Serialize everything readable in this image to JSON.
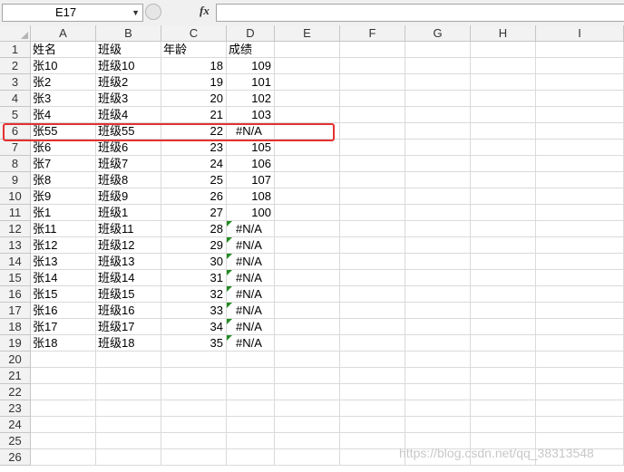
{
  "formula_bar": {
    "name_box": "E17",
    "fx_label": "fx",
    "formula": ""
  },
  "columns": [
    "A",
    "B",
    "C",
    "D",
    "E",
    "F",
    "G",
    "H",
    "I"
  ],
  "rows": [
    "1",
    "2",
    "3",
    "4",
    "5",
    "6",
    "7",
    "8",
    "9",
    "10",
    "11",
    "12",
    "13",
    "14",
    "15",
    "16",
    "17",
    "18",
    "19",
    "20",
    "21",
    "22",
    "23",
    "24",
    "25",
    "26"
  ],
  "table": [
    {
      "a": "姓名",
      "b": "班级",
      "c": "年龄",
      "d": "成绩",
      "c_type": "txt",
      "d_type": "txt",
      "flag": false
    },
    {
      "a": "张10",
      "b": "班级10",
      "c": "18",
      "d": "109",
      "c_type": "num",
      "d_type": "num",
      "flag": false
    },
    {
      "a": "张2",
      "b": "班级2",
      "c": "19",
      "d": "101",
      "c_type": "num",
      "d_type": "num",
      "flag": false
    },
    {
      "a": "张3",
      "b": "班级3",
      "c": "20",
      "d": "102",
      "c_type": "num",
      "d_type": "num",
      "flag": false
    },
    {
      "a": "张4",
      "b": "班级4",
      "c": "21",
      "d": "103",
      "c_type": "num",
      "d_type": "num",
      "flag": false
    },
    {
      "a": "张55",
      "b": "班级55",
      "c": "22",
      "d": "#N/A",
      "c_type": "num",
      "d_type": "err",
      "flag": false
    },
    {
      "a": "张6",
      "b": "班级6",
      "c": "23",
      "d": "105",
      "c_type": "num",
      "d_type": "num",
      "flag": false
    },
    {
      "a": "张7",
      "b": "班级7",
      "c": "24",
      "d": "106",
      "c_type": "num",
      "d_type": "num",
      "flag": false
    },
    {
      "a": "张8",
      "b": "班级8",
      "c": "25",
      "d": "107",
      "c_type": "num",
      "d_type": "num",
      "flag": false
    },
    {
      "a": "张9",
      "b": "班级9",
      "c": "26",
      "d": "108",
      "c_type": "num",
      "d_type": "num",
      "flag": false
    },
    {
      "a": "张1",
      "b": "班级1",
      "c": "27",
      "d": "100",
      "c_type": "num",
      "d_type": "num",
      "flag": false
    },
    {
      "a": "张11",
      "b": "班级11",
      "c": "28",
      "d": "#N/A",
      "c_type": "num",
      "d_type": "err",
      "flag": true
    },
    {
      "a": "张12",
      "b": "班级12",
      "c": "29",
      "d": "#N/A",
      "c_type": "num",
      "d_type": "err",
      "flag": true
    },
    {
      "a": "张13",
      "b": "班级13",
      "c": "30",
      "d": "#N/A",
      "c_type": "num",
      "d_type": "err",
      "flag": true
    },
    {
      "a": "张14",
      "b": "班级14",
      "c": "31",
      "d": "#N/A",
      "c_type": "num",
      "d_type": "err",
      "flag": true
    },
    {
      "a": "张15",
      "b": "班级15",
      "c": "32",
      "d": "#N/A",
      "c_type": "num",
      "d_type": "err",
      "flag": true
    },
    {
      "a": "张16",
      "b": "班级16",
      "c": "33",
      "d": "#N/A",
      "c_type": "num",
      "d_type": "err",
      "flag": true
    },
    {
      "a": "张17",
      "b": "班级17",
      "c": "34",
      "d": "#N/A",
      "c_type": "num",
      "d_type": "err",
      "flag": true
    },
    {
      "a": "张18",
      "b": "班级18",
      "c": "35",
      "d": "#N/A",
      "c_type": "num",
      "d_type": "err",
      "flag": true
    }
  ],
  "watermark": "https://blog.csdn.net/qq_38313548",
  "colors": {
    "highlight_border": "#e53030",
    "error_indicator": "#228b22"
  }
}
